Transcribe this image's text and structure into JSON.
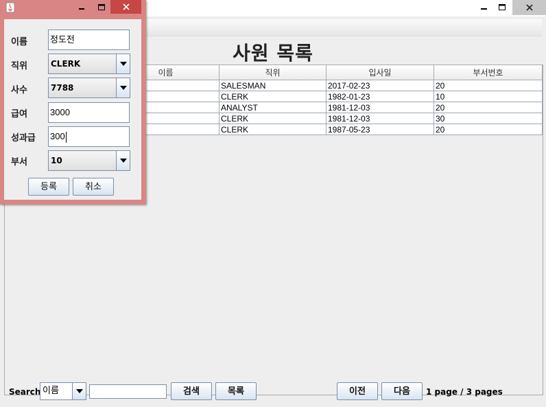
{
  "main_window": {
    "title": "사원 목록",
    "table": {
      "columns": [
        "",
        "이름",
        "직위",
        "입사일",
        "부서번호"
      ],
      "rows": [
        {
          "empno": "",
          "ename": "",
          "job": "SALESMAN",
          "hiredate": "2017-02-23",
          "deptno": "20"
        },
        {
          "empno": "",
          "ename": "",
          "job": "CLERK",
          "hiredate": "1982-01-23",
          "deptno": "10"
        },
        {
          "empno": "",
          "ename": "",
          "job": "ANALYST",
          "hiredate": "1981-12-03",
          "deptno": "20"
        },
        {
          "empno": "",
          "ename": "",
          "job": "CLERK",
          "hiredate": "1981-12-03",
          "deptno": "30"
        },
        {
          "empno": "",
          "ename": "",
          "job": "CLERK",
          "hiredate": "1987-05-23",
          "deptno": "20"
        }
      ]
    },
    "bottom": {
      "search_label": "Search",
      "search_field_selected": "이름",
      "search_value": "",
      "search_button": "검색",
      "list_button": "목록",
      "prev_button": "이전",
      "next_button": "다음",
      "page_current": "1",
      "page_info_text": "page / 3 pages"
    }
  },
  "dialog": {
    "fields": {
      "name": {
        "label": "이름",
        "value": "정도전"
      },
      "job": {
        "label": "직위",
        "value": "CLERK"
      },
      "mgr": {
        "label": "사수",
        "value": "7788"
      },
      "sal": {
        "label": "급여",
        "value": "3000"
      },
      "comm": {
        "label": "성과급",
        "value": "300"
      },
      "dept": {
        "label": "부서",
        "value": "10"
      }
    },
    "register_button": "등록",
    "cancel_button": "취소"
  },
  "colors": {
    "dialog_frame": "#d88686",
    "close_button_active": "#c74646",
    "button_gradient_bottom": "#d9e4f1",
    "grid_line": "#9aa6b6"
  },
  "icons": [
    "java-app-icon",
    "minimize-icon",
    "maximize-icon",
    "close-icon",
    "chevron-down-icon"
  ]
}
